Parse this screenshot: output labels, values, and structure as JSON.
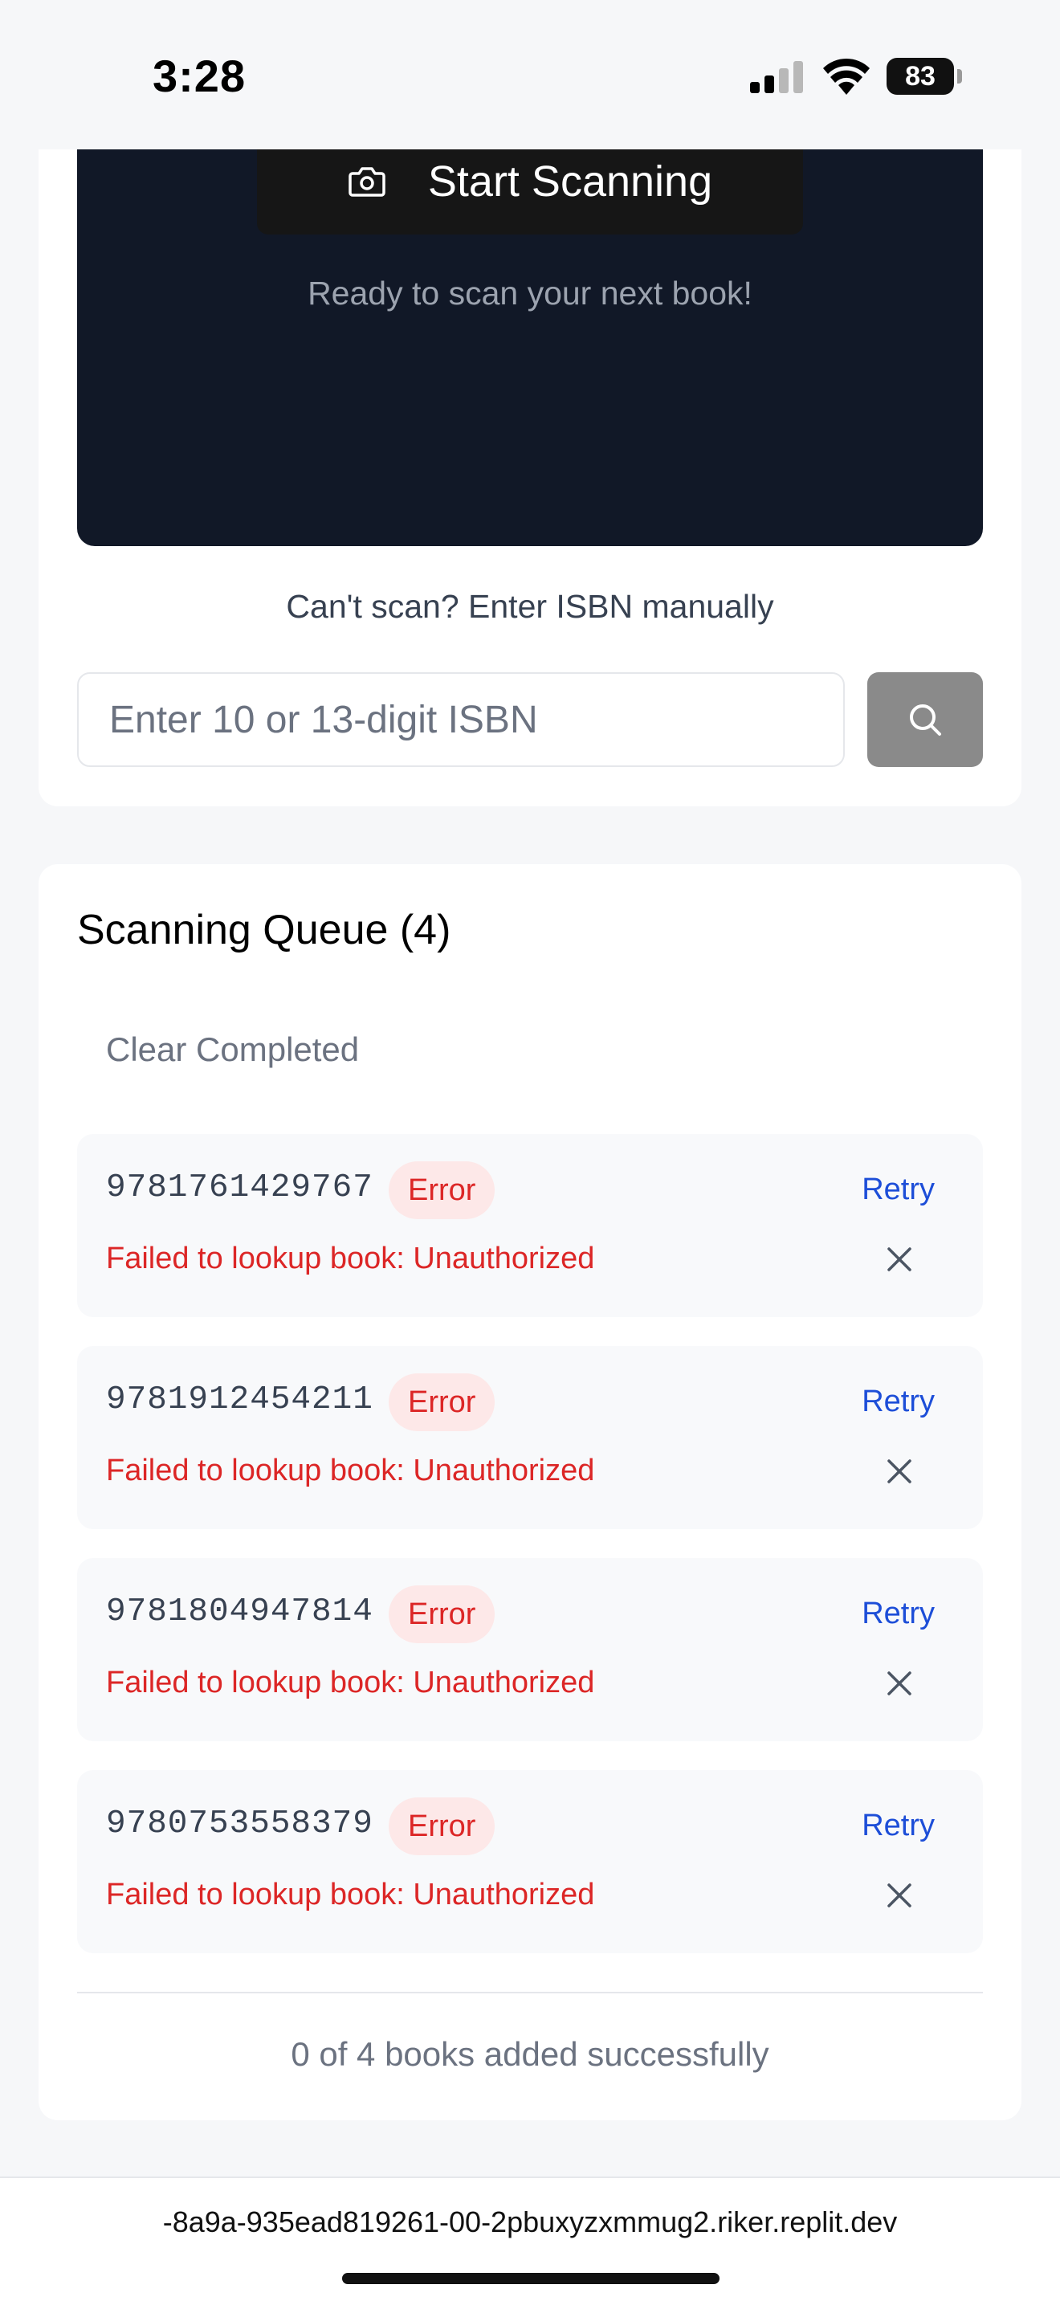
{
  "status_bar": {
    "time": "3:28",
    "battery": "83",
    "icons": [
      "signal-icon",
      "wifi-icon",
      "battery-icon"
    ]
  },
  "scanner": {
    "start_label": "Start Scanning",
    "start_icon": "camera-icon",
    "ready_text": "Ready to scan your next book!",
    "manual_label": "Can't scan? Enter ISBN manually",
    "isbn_placeholder": "Enter 10 or 13-digit ISBN",
    "isbn_value": "",
    "search_icon": "search-icon"
  },
  "queue": {
    "title": "Scanning Queue (4)",
    "clear_label": "Clear Completed",
    "items": [
      {
        "isbn": "9781761429767",
        "status": "Error",
        "action": "Retry",
        "message": "Failed to lookup book: Unauthorized"
      },
      {
        "isbn": "9781912454211",
        "status": "Error",
        "action": "Retry",
        "message": "Failed to lookup book: Unauthorized"
      },
      {
        "isbn": "9781804947814",
        "status": "Error",
        "action": "Retry",
        "message": "Failed to lookup book: Unauthorized"
      },
      {
        "isbn": "9780753558379",
        "status": "Error",
        "action": "Retry",
        "message": "Failed to lookup book: Unauthorized"
      }
    ],
    "summary": "0 of 4 books added successfully"
  },
  "browser": {
    "url": "-8a9a-935ead819261-00-2pbuxyzxmmug2.riker.replit.dev"
  },
  "colors": {
    "camera_bg": "#111827",
    "error_red": "#dc2626",
    "error_badge_bg": "#fde8e8",
    "link_blue": "#1d4ed8",
    "search_btn_bg": "#8a8a8a"
  }
}
